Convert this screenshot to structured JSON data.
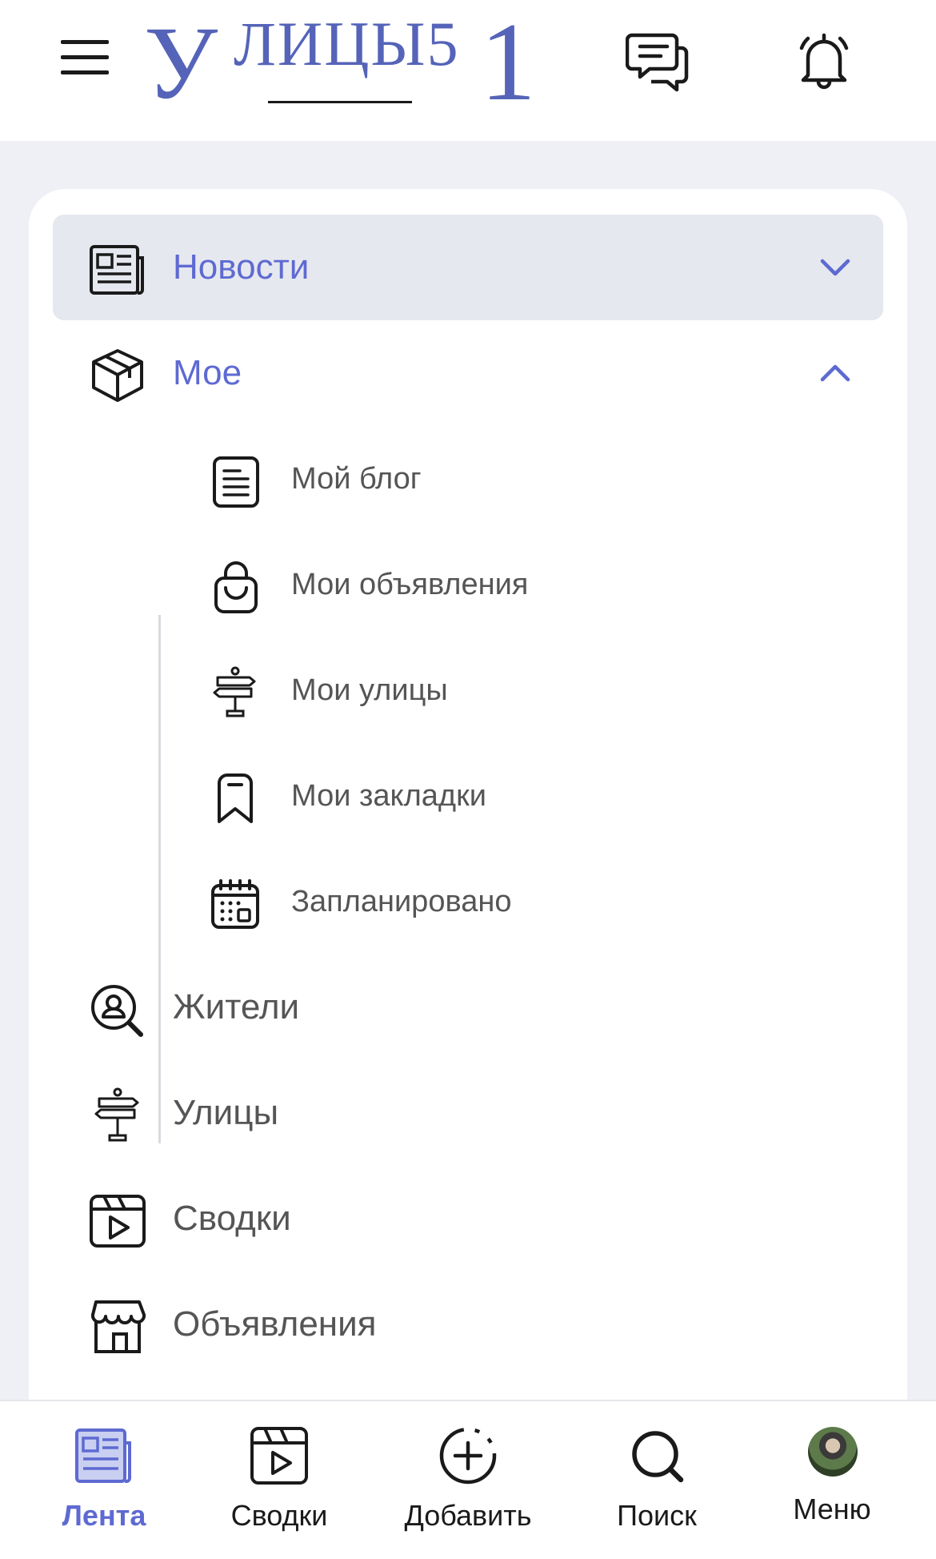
{
  "header": {
    "logo": {
      "l1": "У",
      "l2": "ЛИЦЫ5",
      "l3": "1"
    }
  },
  "menu": {
    "news": {
      "label": "Новости",
      "expanded": false
    },
    "mine": {
      "label": "Мое",
      "expanded": true,
      "items": [
        {
          "label": "Мой блог",
          "icon": "document-icon"
        },
        {
          "label": "Мои объявления",
          "icon": "shopping-bag-icon"
        },
        {
          "label": "Мои улицы",
          "icon": "signpost-icon"
        },
        {
          "label": "Мои закладки",
          "icon": "bookmark-icon"
        },
        {
          "label": "Запланировано",
          "icon": "calendar-icon"
        }
      ]
    },
    "residents": {
      "label": "Жители"
    },
    "streets": {
      "label": "Улицы"
    },
    "summaries": {
      "label": "Сводки"
    },
    "ads": {
      "label": "Объявления"
    }
  },
  "bottom_nav": {
    "feed": "Лента",
    "summaries": "Сводки",
    "add": "Добавить",
    "search": "Поиск",
    "menu": "Меню",
    "active": "feed"
  },
  "colors": {
    "accent": "#5e6ad2",
    "logo": "#5564b8",
    "background": "#eef0f5"
  }
}
